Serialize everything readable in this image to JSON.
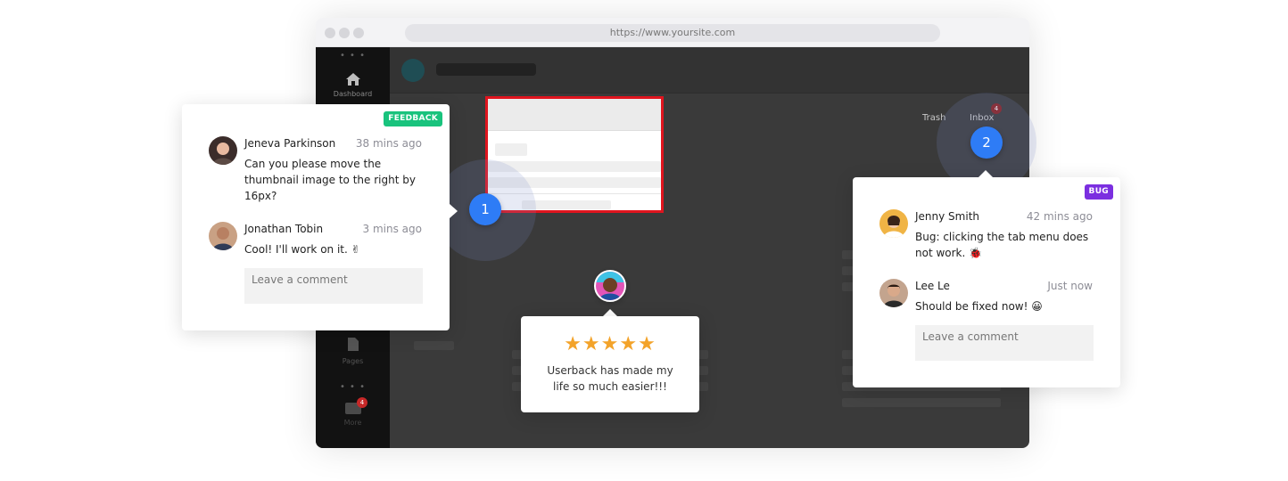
{
  "browser": {
    "url": "https://www.yoursite.com"
  },
  "app": {
    "sidebar": {
      "dashboard_label": "Dashboard",
      "pages_label": "Pages",
      "notifications_badge": "4",
      "more_label": "More"
    },
    "tabs": {
      "trash_label": "Trash",
      "inbox_label": "Inbox",
      "inbox_badge": "4"
    }
  },
  "markers": {
    "one": "1",
    "two": "2"
  },
  "feedback_card": {
    "tag": "FEEDBACK",
    "tag_color": "#19c37d",
    "comments": [
      {
        "author": "Jeneva Parkinson",
        "time": "38 mins ago",
        "text": "Can you please move the thumbnail image to the right by 16px?"
      },
      {
        "author": "Jonathan Tobin",
        "time": "3 mins ago",
        "text": "Cool! I'll work on it. ✌"
      }
    ],
    "input_placeholder": "Leave a comment"
  },
  "bug_card": {
    "tag": "BUG",
    "tag_color": "#7b2fe0",
    "comments": [
      {
        "author": "Jenny Smith",
        "time": "42 mins ago",
        "text": "Bug: clicking the tab menu does not work. 🐞"
      },
      {
        "author": "Lee Le",
        "time": "Just now",
        "text": "Should be fixed now! 😀"
      }
    ],
    "input_placeholder": "Leave a comment"
  },
  "review": {
    "stars": "★★★★★",
    "rating": 5,
    "text": "Userback has made my life so much easier!!!"
  },
  "colors": {
    "accent_blue": "#2e7cf6",
    "highlight_red": "#e0141e",
    "star_orange": "#f3a32a"
  }
}
